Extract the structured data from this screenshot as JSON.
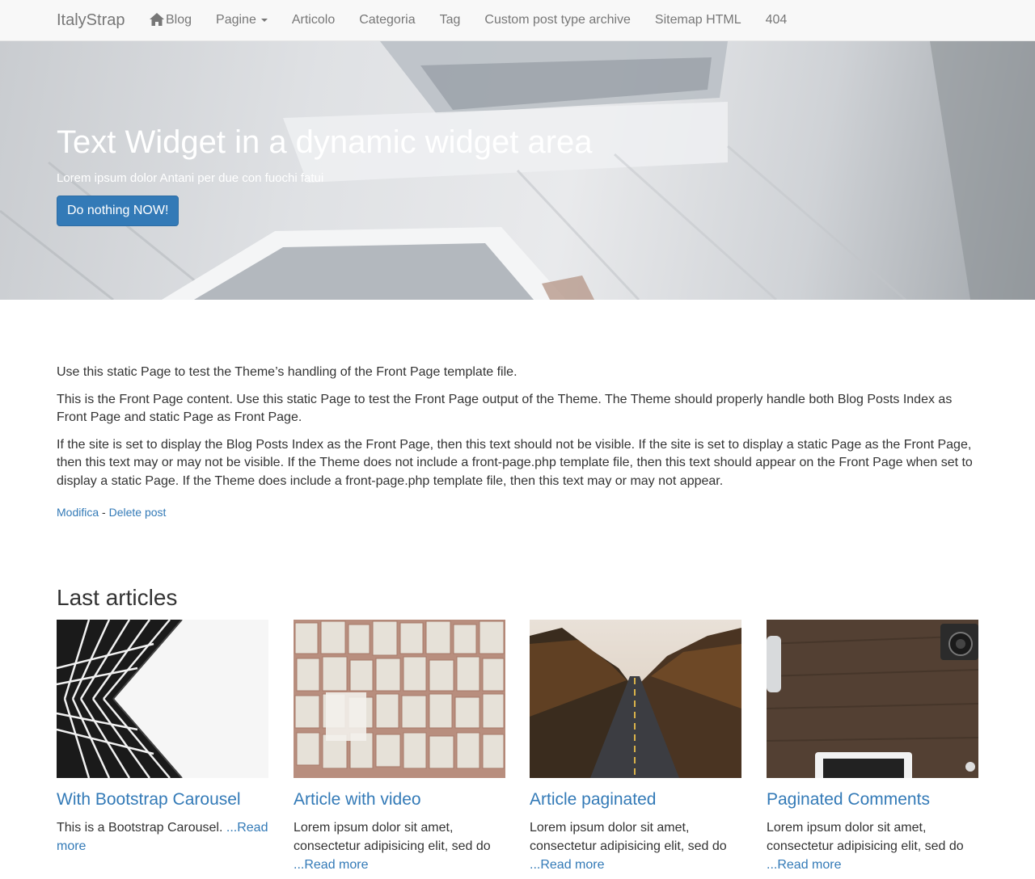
{
  "navbar": {
    "brand": "ItalyStrap",
    "items": [
      {
        "label": "Blog",
        "icon": "home-icon"
      },
      {
        "label": "Pagine",
        "icon": "caret-down-icon"
      },
      {
        "label": "Articolo"
      },
      {
        "label": "Categoria"
      },
      {
        "label": "Tag"
      },
      {
        "label": "Custom post type archive"
      },
      {
        "label": "Sitemap HTML"
      },
      {
        "label": "404"
      }
    ]
  },
  "hero": {
    "title": "Text Widget in a dynamic widget area",
    "subtitle": "Lorem ipsum dolor Antani per due con fuochi fatui",
    "button_label": "Do nothing NOW!"
  },
  "content": {
    "paragraphs": [
      "Use this static Page to test the Theme’s handling of the Front Page template file.",
      "This is the Front Page content. Use this static Page to test the Front Page output of the Theme. The Theme should properly handle both Blog Posts Index as Front Page and static Page as Front Page.",
      "If the site is set to display the Blog Posts Index as the Front Page, then this text should not be visible. If the site is set to display a static Page as the Front Page, then this text may or may not be visible. If the Theme does not include a front-page.php template file, then this text should appear on the Front Page when set to display a static Page. If the Theme does include a front-page.php template file, then this text may or may not appear."
    ],
    "edit_label": "Modifica",
    "separator": " - ",
    "delete_label": "Delete post"
  },
  "articles": {
    "title": "Last articles",
    "items": [
      {
        "title": "With Bootstrap Carousel",
        "excerpt": "This is a Bootstrap Carousel. ",
        "read_more": "...Read more",
        "thumb": "architecture-photo"
      },
      {
        "title": "Article with video",
        "excerpt": "Lorem ipsum dolor sit amet, consectetur adipisicing elit, sed do ",
        "read_more": "...Read more",
        "thumb": "book-pages-photo"
      },
      {
        "title": "Article paginated",
        "excerpt": "Lorem ipsum dolor sit amet, consectetur adipisicing elit, sed do ",
        "read_more": "...Read more",
        "thumb": "road-forest-photo"
      },
      {
        "title": "Paginated Comments",
        "excerpt": "Lorem ipsum dolor sit amet, consectetur adipisicing elit, sed do ",
        "read_more": "...Read more",
        "thumb": "wooden-desk-photo"
      }
    ]
  },
  "colors": {
    "link": "#337ab7",
    "navbar_bg": "#f8f8f8",
    "button": "#337ab7",
    "text": "#333333"
  }
}
